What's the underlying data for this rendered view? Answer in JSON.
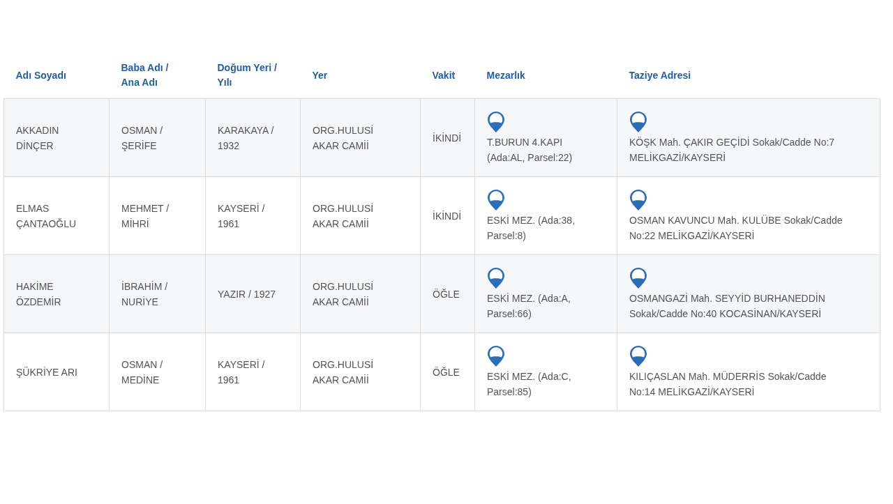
{
  "table": {
    "columns": [
      "Adı Soyadı",
      "Baba Adı / Ana Adı",
      "Doğum Yeri / Yılı",
      "Yer",
      "Vakit",
      "Mezarlık",
      "Taziye Adresi"
    ],
    "rows": [
      {
        "name": "AKKADIN DİNÇER",
        "parents": "OSMAN / ŞERİFE",
        "birth": "KARAKAYA / 1932",
        "place": "ORG.HULUSİ AKAR CAMİİ",
        "time": "İKİNDİ",
        "cemetery": "T.BURUN 4.KAPI (Ada:AL, Parsel:22)",
        "address": "KÖŞK Mah. ÇAKIR GEÇİDİ Sokak/Cadde No:7 MELİKGAZİ/KAYSERİ"
      },
      {
        "name": "ELMAS ÇANTAOĞLU",
        "parents": "MEHMET / MİHRİ",
        "birth": "KAYSERİ / 1961",
        "place": "ORG.HULUSİ AKAR CAMİİ",
        "time": "İKİNDİ",
        "cemetery": "ESKİ MEZ. (Ada:38, Parsel:8)",
        "address": "OSMAN KAVUNCU Mah. KULÜBE Sokak/Cadde No:22 MELİKGAZİ/KAYSERİ"
      },
      {
        "name": "HAKİME ÖZDEMİR",
        "parents": "İBRAHİM / NURİYE",
        "birth": "YAZIR / 1927",
        "place": "ORG.HULUSİ AKAR CAMİİ",
        "time": "ÖĞLE",
        "cemetery": "ESKİ MEZ. (Ada:A, Parsel:66)",
        "address": "OSMANGAZİ Mah. SEYYİD BURHANEDDİN Sokak/Cadde No:40 KOCASİNAN/KAYSERİ"
      },
      {
        "name": "ŞÜKRİYE ARI",
        "parents": "OSMAN / MEDİNE",
        "birth": "KAYSERİ / 1961",
        "place": "ORG.HULUSİ AKAR CAMİİ",
        "time": "ÖĞLE",
        "cemetery": "ESKİ MEZ. (Ada:C, Parsel:85)",
        "address": "KILIÇASLAN Mah. MÜDERRİS Sokak/Cadde No:14 MELİKGAZİ/KAYSERİ"
      }
    ]
  }
}
